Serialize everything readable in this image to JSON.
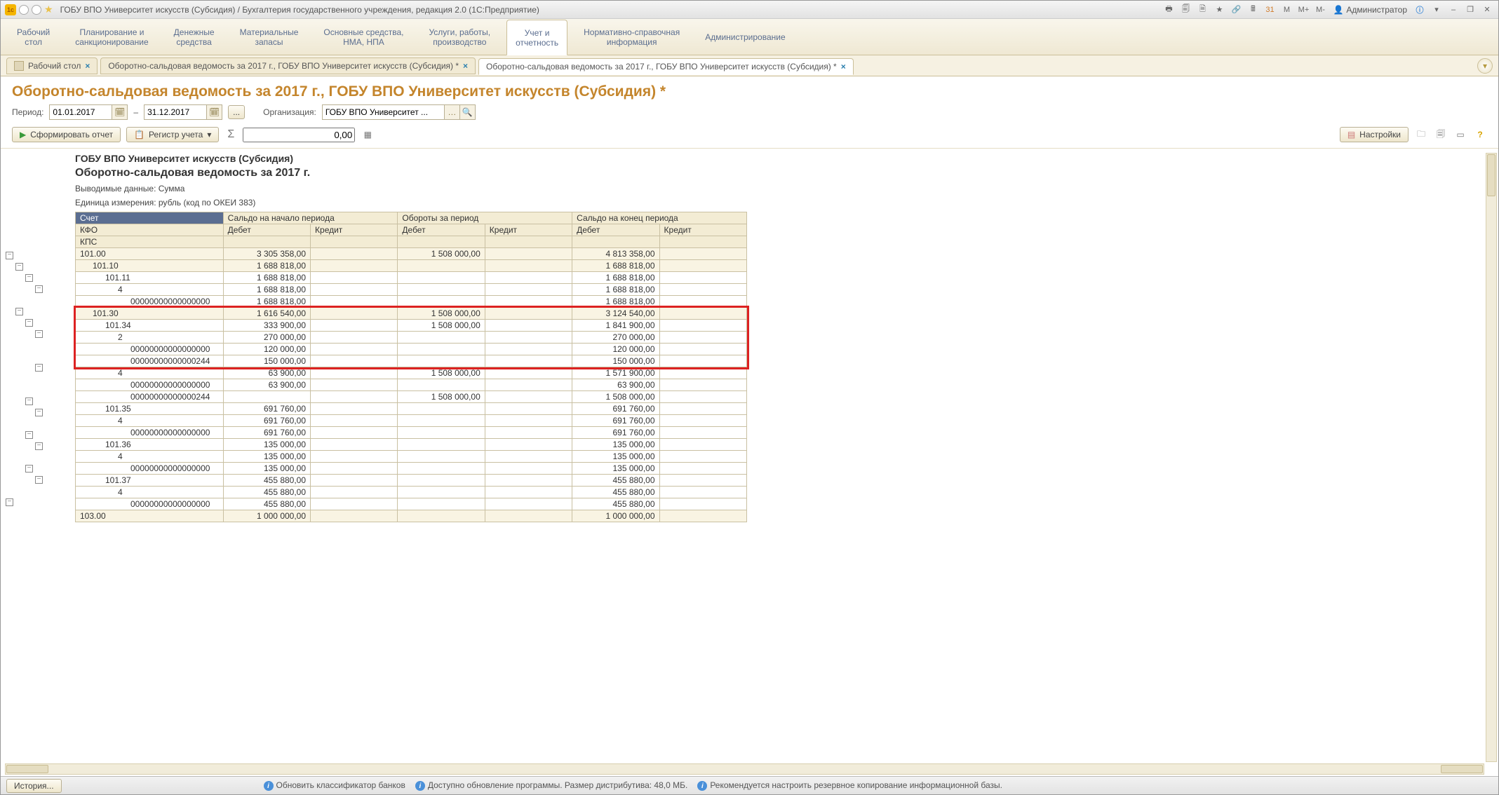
{
  "titlebar": {
    "title": "ГОБУ ВПО Университет искусств (Субсидия) / Бухгалтерия государственного учреждения, редакция 2.0  (1С:Предприятие)",
    "user": "Администратор",
    "mem_buttons": [
      "M",
      "M+",
      "M-"
    ]
  },
  "sections": [
    "Рабочий\nстол",
    "Планирование и\nсанкционирование",
    "Денежные\nсредства",
    "Материальные\nзапасы",
    "Основные средства,\nНМА, НПА",
    "Услуги, работы,\nпроизводство",
    "Учет и\nотчетность",
    "Нормативно-справочная\nинформация",
    "Администрирование"
  ],
  "active_section_index": 6,
  "tabs": [
    {
      "label": "Рабочий стол",
      "closable": true,
      "icon": "desktop"
    },
    {
      "label": "Оборотно-сальдовая ведомость за 2017 г., ГОБУ ВПО Университет искусств (Субсидия) *",
      "closable": true
    },
    {
      "label": "Оборотно-сальдовая ведомость за 2017 г., ГОБУ ВПО Университет искусств (Субсидия) *",
      "closable": true
    }
  ],
  "active_tab_index": 2,
  "page_title": "Оборотно-сальдовая ведомость за 2017 г., ГОБУ ВПО Университет искусств (Субсидия) *",
  "filters": {
    "period_label": "Период:",
    "date_from": "01.01.2017",
    "dash": "–",
    "date_to": "31.12.2017",
    "ellipsis": "...",
    "org_label": "Организация:",
    "org_value": "ГОБУ ВПО Университет ..."
  },
  "toolbar": {
    "run_label": "Сформировать отчет",
    "register_label": "Регистр учета",
    "num_value": "0,00",
    "settings_label": "Настройки"
  },
  "report_header": {
    "org": "ГОБУ ВПО Университет искусств (Субсидия)",
    "title": "Оборотно-сальдовая ведомость за 2017 г.",
    "data_line": "Выводимые данные:  Сумма",
    "unit_line": "Единица измерения: рубль (код по ОКЕИ 383)"
  },
  "columns": {
    "c1a": "Счет",
    "c1b": "КФО",
    "c1c": "КПС",
    "g1": "Сальдо на начало периода",
    "g2": "Обороты за период",
    "g3": "Сальдо на конец периода",
    "d": "Дебет",
    "k": "Кредит"
  },
  "rows": [
    {
      "lvl": 0,
      "acc": "101.00",
      "sd": "3 305 358,00",
      "sk": "",
      "od": "1 508 000,00",
      "ok": "",
      "ed": "4 813 358,00",
      "ek": "",
      "tot": true
    },
    {
      "lvl": 1,
      "acc": "101.10",
      "sd": "1 688 818,00",
      "sk": "",
      "od": "",
      "ok": "",
      "ed": "1 688 818,00",
      "ek": "",
      "tot": true
    },
    {
      "lvl": 2,
      "acc": "101.11",
      "sd": "1 688 818,00",
      "sk": "",
      "od": "",
      "ok": "",
      "ed": "1 688 818,00",
      "ek": ""
    },
    {
      "lvl": 3,
      "acc": "4",
      "sd": "1 688 818,00",
      "sk": "",
      "od": "",
      "ok": "",
      "ed": "1 688 818,00",
      "ek": ""
    },
    {
      "lvl": 4,
      "acc": "00000000000000000",
      "sd": "1 688 818,00",
      "sk": "",
      "od": "",
      "ok": "",
      "ed": "1 688 818,00",
      "ek": ""
    },
    {
      "lvl": 1,
      "acc": "101.30",
      "sd": "1 616 540,00",
      "sk": "",
      "od": "1 508 000,00",
      "ok": "",
      "ed": "3 124 540,00",
      "ek": "",
      "tot": true,
      "hl": true
    },
    {
      "lvl": 2,
      "acc": "101.34",
      "sd": "333 900,00",
      "sk": "",
      "od": "1 508 000,00",
      "ok": "",
      "ed": "1 841 900,00",
      "ek": "",
      "hl": true
    },
    {
      "lvl": 3,
      "acc": "2",
      "sd": "270 000,00",
      "sk": "",
      "od": "",
      "ok": "",
      "ed": "270 000,00",
      "ek": "",
      "hl": true
    },
    {
      "lvl": 4,
      "acc": "00000000000000000",
      "sd": "120 000,00",
      "sk": "",
      "od": "",
      "ok": "",
      "ed": "120 000,00",
      "ek": "",
      "hl": true
    },
    {
      "lvl": 4,
      "acc": "00000000000000244",
      "sd": "150 000,00",
      "sk": "",
      "od": "",
      "ok": "",
      "ed": "150 000,00",
      "ek": "",
      "hl": true
    },
    {
      "lvl": 3,
      "acc": "4",
      "sd": "63 900,00",
      "sk": "",
      "od": "1 508 000,00",
      "ok": "",
      "ed": "1 571 900,00",
      "ek": ""
    },
    {
      "lvl": 4,
      "acc": "00000000000000000",
      "sd": "63 900,00",
      "sk": "",
      "od": "",
      "ok": "",
      "ed": "63 900,00",
      "ek": ""
    },
    {
      "lvl": 4,
      "acc": "00000000000000244",
      "sd": "",
      "sk": "",
      "od": "1 508 000,00",
      "ok": "",
      "ed": "1 508 000,00",
      "ek": ""
    },
    {
      "lvl": 2,
      "acc": "101.35",
      "sd": "691 760,00",
      "sk": "",
      "od": "",
      "ok": "",
      "ed": "691 760,00",
      "ek": ""
    },
    {
      "lvl": 3,
      "acc": "4",
      "sd": "691 760,00",
      "sk": "",
      "od": "",
      "ok": "",
      "ed": "691 760,00",
      "ek": ""
    },
    {
      "lvl": 4,
      "acc": "00000000000000000",
      "sd": "691 760,00",
      "sk": "",
      "od": "",
      "ok": "",
      "ed": "691 760,00",
      "ek": ""
    },
    {
      "lvl": 2,
      "acc": "101.36",
      "sd": "135 000,00",
      "sk": "",
      "od": "",
      "ok": "",
      "ed": "135 000,00",
      "ek": ""
    },
    {
      "lvl": 3,
      "acc": "4",
      "sd": "135 000,00",
      "sk": "",
      "od": "",
      "ok": "",
      "ed": "135 000,00",
      "ek": ""
    },
    {
      "lvl": 4,
      "acc": "00000000000000000",
      "sd": "135 000,00",
      "sk": "",
      "od": "",
      "ok": "",
      "ed": "135 000,00",
      "ek": ""
    },
    {
      "lvl": 2,
      "acc": "101.37",
      "sd": "455 880,00",
      "sk": "",
      "od": "",
      "ok": "",
      "ed": "455 880,00",
      "ek": ""
    },
    {
      "lvl": 3,
      "acc": "4",
      "sd": "455 880,00",
      "sk": "",
      "od": "",
      "ok": "",
      "ed": "455 880,00",
      "ek": ""
    },
    {
      "lvl": 4,
      "acc": "00000000000000000",
      "sd": "455 880,00",
      "sk": "",
      "od": "",
      "ok": "",
      "ed": "455 880,00",
      "ek": ""
    },
    {
      "lvl": 0,
      "acc": "103.00",
      "sd": "1 000 000,00",
      "sk": "",
      "od": "",
      "ok": "",
      "ed": "1 000 000,00",
      "ek": "",
      "tot": true
    }
  ],
  "statusbar": {
    "history": "История...",
    "msg1": "Обновить классификатор банков",
    "msg2": "Доступно обновление программы. Размер дистрибутива: 48,0 МБ.",
    "msg3": "Рекомендуется настроить резервное копирование информационной базы."
  }
}
